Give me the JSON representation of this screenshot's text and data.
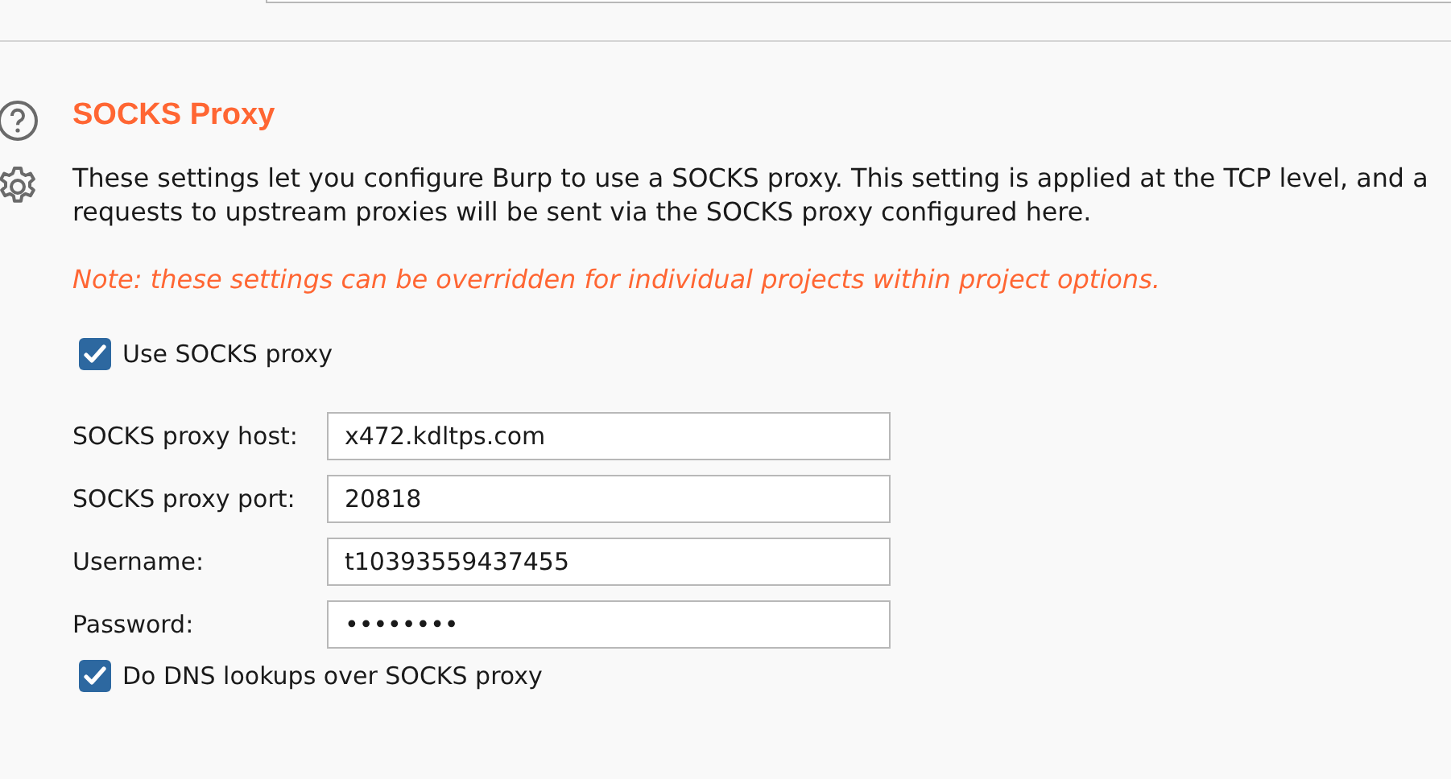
{
  "section": {
    "title": "SOCKS Proxy",
    "description": "These settings let you configure Burp to use a SOCKS proxy. This setting is applied at the TCP level, and a\nrequests to upstream proxies will be sent via the SOCKS proxy configured here.",
    "note": "Note: these settings can be overridden for individual projects within project options.",
    "use_proxy": {
      "label": "Use SOCKS proxy",
      "checked": true
    },
    "fields": [
      {
        "label": "SOCKS proxy host:",
        "value": "x472.kdltps.com"
      },
      {
        "label": "SOCKS proxy port:",
        "value": "20818"
      },
      {
        "label": "Username:",
        "value": "t10393559437455"
      },
      {
        "label": "Password:",
        "value": "••••••••"
      }
    ],
    "dns_lookup": {
      "label": "Do DNS lookups over SOCKS proxy",
      "checked": true
    }
  }
}
